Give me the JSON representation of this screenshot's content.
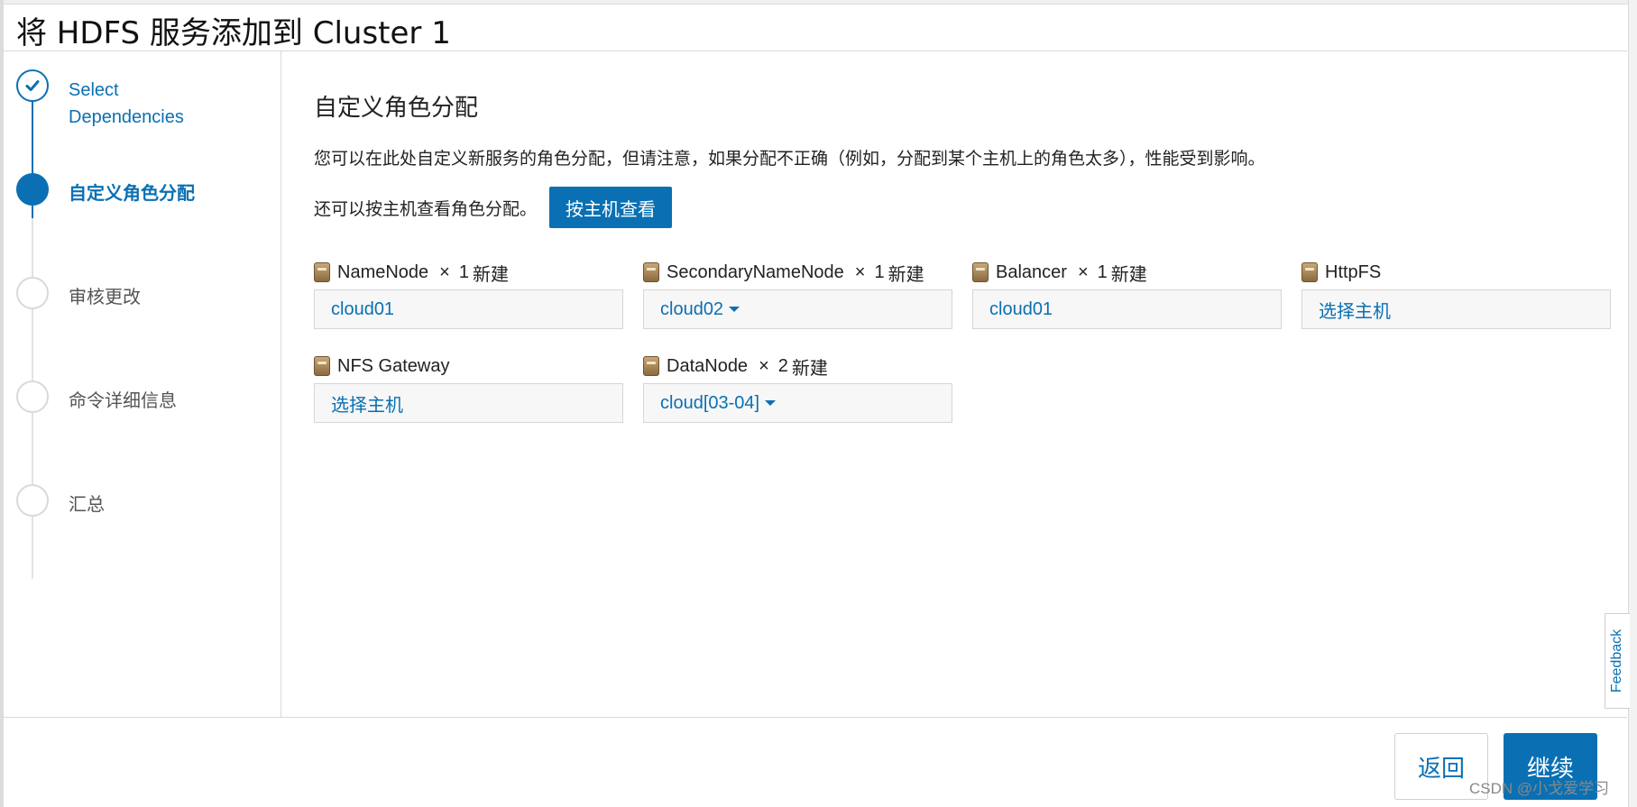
{
  "header": {
    "title": "将 HDFS 服务添加到 Cluster 1"
  },
  "steps": [
    {
      "label": "Select Dependencies",
      "state": "done"
    },
    {
      "label": "自定义角色分配",
      "state": "active"
    },
    {
      "label": "审核更改",
      "state": "pending"
    },
    {
      "label": "命令详细信息",
      "state": "pending"
    },
    {
      "label": "汇总",
      "state": "pending"
    }
  ],
  "main": {
    "title": "自定义角色分配",
    "description": "您可以在此处自定义新服务的角色分配，但请注意，如果分配不正确（例如，分配到某个主机上的角色太多），性能受到影响。",
    "host_view_text": "还可以按主机查看角色分配。",
    "host_view_button": "按主机查看",
    "roles": [
      {
        "name": "NameNode",
        "mult": "×",
        "count": "1",
        "suffix": "新建",
        "value": "cloud01"
      },
      {
        "name": "SecondaryNameNode",
        "mult": "×",
        "count": "1",
        "suffix": "新建",
        "value": "cloud02"
      },
      {
        "name": "Balancer",
        "mult": "×",
        "count": "1",
        "suffix": "新建",
        "value": "cloud01"
      },
      {
        "name": "HttpFS",
        "value": "选择主机"
      },
      {
        "name": "NFS Gateway",
        "value": "选择主机"
      },
      {
        "name": "DataNode",
        "mult": "×",
        "count": "2",
        "suffix": "新建",
        "value": "cloud[03-04]"
      }
    ]
  },
  "feedback": {
    "label": "Feedback"
  },
  "footer": {
    "back_label": "返回",
    "continue_label": "继续"
  },
  "watermark": "CSDN @小戈爱学习",
  "colors": {
    "accent": "#0a70b3",
    "border": "#d8d8d8",
    "field_bg": "#f7f7f7"
  },
  "icons": {
    "step_done": "check-icon",
    "role": "role-server-icon",
    "dropdown": "caret-down-icon"
  }
}
